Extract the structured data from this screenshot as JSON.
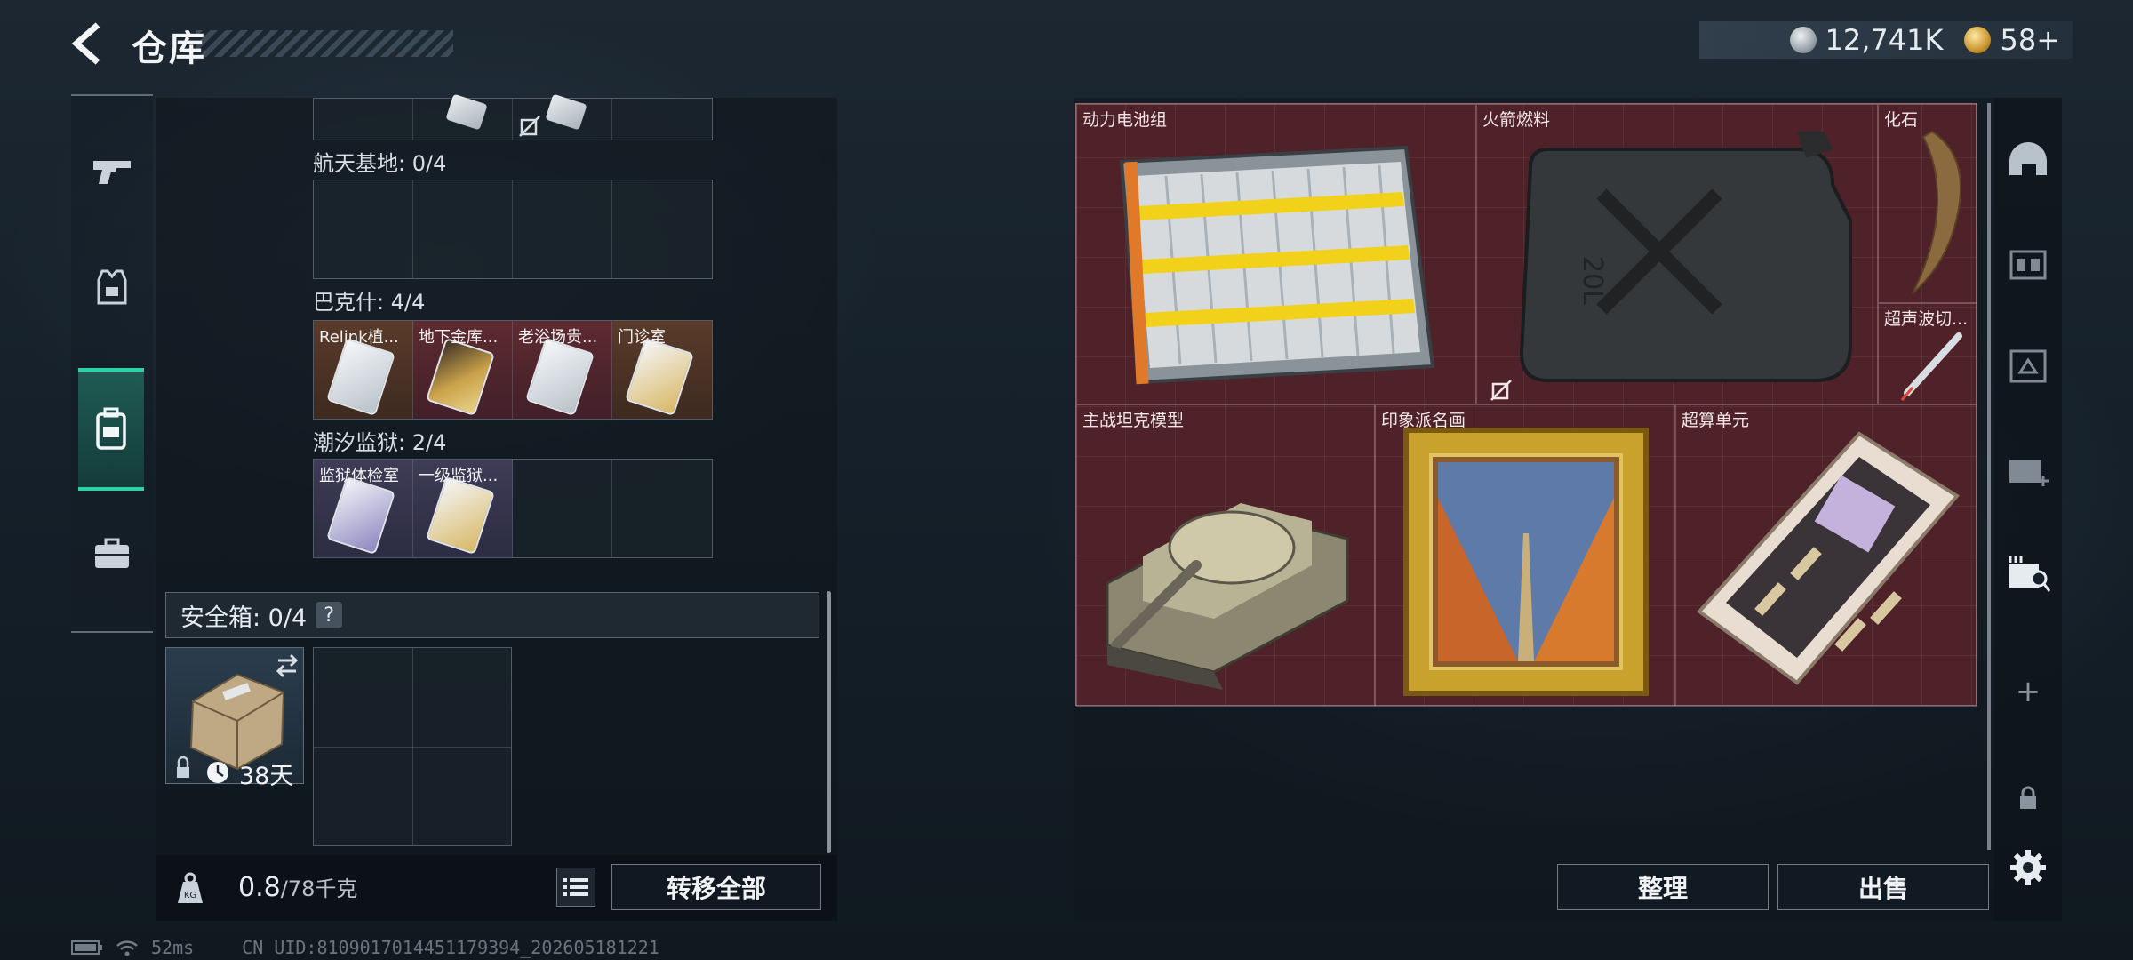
{
  "header": {
    "title": "仓库",
    "currency_primary": "12,741K",
    "currency_secondary": "58+"
  },
  "left_rail": {
    "items": [
      {
        "icon": "gun-icon",
        "active": false
      },
      {
        "icon": "vest-icon",
        "active": false
      },
      {
        "icon": "backpack-icon",
        "active": true
      },
      {
        "icon": "briefcase-icon",
        "active": false
      }
    ]
  },
  "stash": {
    "sections": [
      {
        "label": "航天基地: 0/4",
        "slots": []
      },
      {
        "label": "巴克什: 4/4",
        "slots": [
          {
            "name": "Relink植...",
            "color": "brown",
            "card": "white"
          },
          {
            "name": "地下金库...",
            "color": "red",
            "card": "gold"
          },
          {
            "name": "老浴场贵...",
            "color": "red",
            "card": "white"
          },
          {
            "name": "门诊室",
            "color": "brown",
            "card": "goldw"
          }
        ]
      },
      {
        "label": "潮汐监狱: 2/4",
        "slots": [
          {
            "name": "监狱体检室",
            "color": "purple",
            "card": "purplec"
          },
          {
            "name": "一级监狱...",
            "color": "purple",
            "card": "goldw"
          }
        ]
      }
    ],
    "safebox": {
      "label": "安全箱: 0/4",
      "help": "?",
      "duration": "38天"
    },
    "weight": {
      "current": "0.8",
      "max": "/78千克"
    },
    "transfer_all": "转移全部"
  },
  "backpack": {
    "items": [
      {
        "name": "动力电池组",
        "icon": "battery-pack-icon"
      },
      {
        "name": "火箭燃料",
        "icon": "fuel-canister-icon",
        "canister_label": "20L"
      },
      {
        "name": "化石",
        "icon": "fossil-claw-icon"
      },
      {
        "name": "超声波切...",
        "icon": "ultrasonic-cutter-icon"
      },
      {
        "name": "主战坦克模型",
        "icon": "tank-model-icon"
      },
      {
        "name": "印象派名画",
        "icon": "painting-icon"
      },
      {
        "name": "超算单元",
        "icon": "supercomputer-unit-icon"
      }
    ],
    "sort_button": "整理",
    "sell_button": "出售"
  },
  "right_rail": {
    "items": [
      "helmet-icon",
      "chest-rig-icon",
      "crate-icon",
      "medkit-icon",
      "collector-icon",
      "add-icon",
      "lock-icon",
      "settings-icon"
    ],
    "add_symbol": "+"
  },
  "status": {
    "ping": "52ms",
    "uid": "CN UID:8109017014451179394_202605181221"
  },
  "colors": {
    "accent": "#2bd4a6",
    "backpack_bg": "#4f2128"
  }
}
